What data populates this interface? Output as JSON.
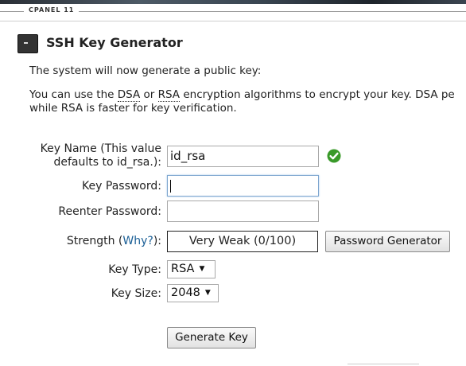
{
  "header": {
    "brand": "CPANEL 11"
  },
  "page": {
    "title": "SSH Key Generator",
    "intro": "The system will now generate a public key:",
    "desc_line1_pre": "You can use the ",
    "desc_dsa": "DSA",
    "desc_line1_mid": " or ",
    "desc_rsa": "RSA",
    "desc_line1_post": " encryption algorithms to encrypt your key. DSA pe",
    "desc_line2": "while RSA is faster for key verification."
  },
  "form": {
    "key_name_label_line1": "Key Name (This value",
    "key_name_label_line2": "defaults to id_rsa.):",
    "key_name_value": "id_rsa",
    "key_password_label": "Key Password:",
    "key_password_value": "",
    "reenter_password_label": "Reenter Password:",
    "reenter_password_value": "",
    "strength_label_pre": "Strength (",
    "strength_why": "Why?",
    "strength_label_post": "):",
    "strength_value": "Very Weak (0/100)",
    "password_generator_label": "Password Generator",
    "key_type_label": "Key Type:",
    "key_type_value": "RSA",
    "key_size_label": "Key Size:",
    "key_size_value": "2048",
    "generate_key_label": "Generate Key"
  },
  "icons": {
    "page": "terminal-icon",
    "valid": "check-circle-icon",
    "dropdown": "dropdown-arrow-icon"
  },
  "colors": {
    "valid_green": "#3a9a2a",
    "link_blue": "#1a5f96"
  }
}
